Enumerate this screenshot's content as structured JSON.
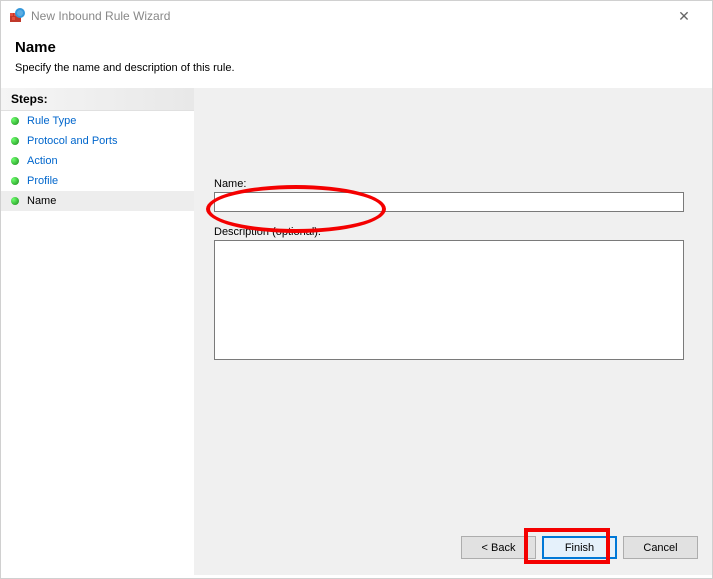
{
  "window": {
    "title": "New Inbound Rule Wizard"
  },
  "header": {
    "title": "Name",
    "subtitle": "Specify the name and description of this rule."
  },
  "sidebar": {
    "header": "Steps:",
    "items": [
      {
        "label": "Rule Type"
      },
      {
        "label": "Protocol and Ports"
      },
      {
        "label": "Action"
      },
      {
        "label": "Profile"
      },
      {
        "label": "Name"
      }
    ]
  },
  "form": {
    "name_label": "Name:",
    "name_value": "",
    "desc_label": "Description (optional):",
    "desc_value": ""
  },
  "buttons": {
    "back": "< Back",
    "finish": "Finish",
    "cancel": "Cancel"
  }
}
